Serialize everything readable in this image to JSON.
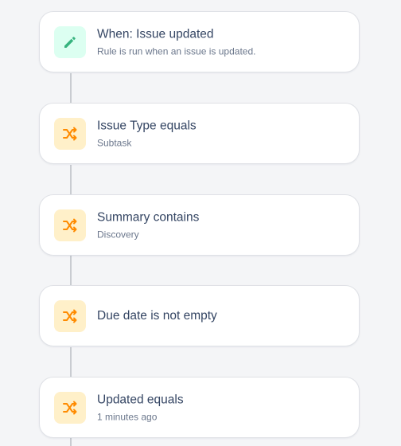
{
  "colors": {
    "trigger_icon": "#36b37e",
    "trigger_icon_bg": "#dcfff1",
    "condition_icon": "#ff8b00",
    "condition_icon_bg": "#fff0c9",
    "title_text": "#344563",
    "subtitle_text": "#6b778c"
  },
  "rule": {
    "trigger": {
      "icon": "pencil-icon",
      "title": "When: Issue updated",
      "subtitle": "Rule is run when an issue is updated."
    },
    "conditions": [
      {
        "icon": "shuffle-icon",
        "title": "Issue Type equals",
        "subtitle": "Subtask"
      },
      {
        "icon": "shuffle-icon",
        "title": "Summary contains",
        "subtitle": "Discovery"
      },
      {
        "icon": "shuffle-icon",
        "title": "Due date is not empty",
        "subtitle": ""
      },
      {
        "icon": "shuffle-icon",
        "title": "Updated equals",
        "subtitle": "1 minutes ago"
      }
    ]
  }
}
